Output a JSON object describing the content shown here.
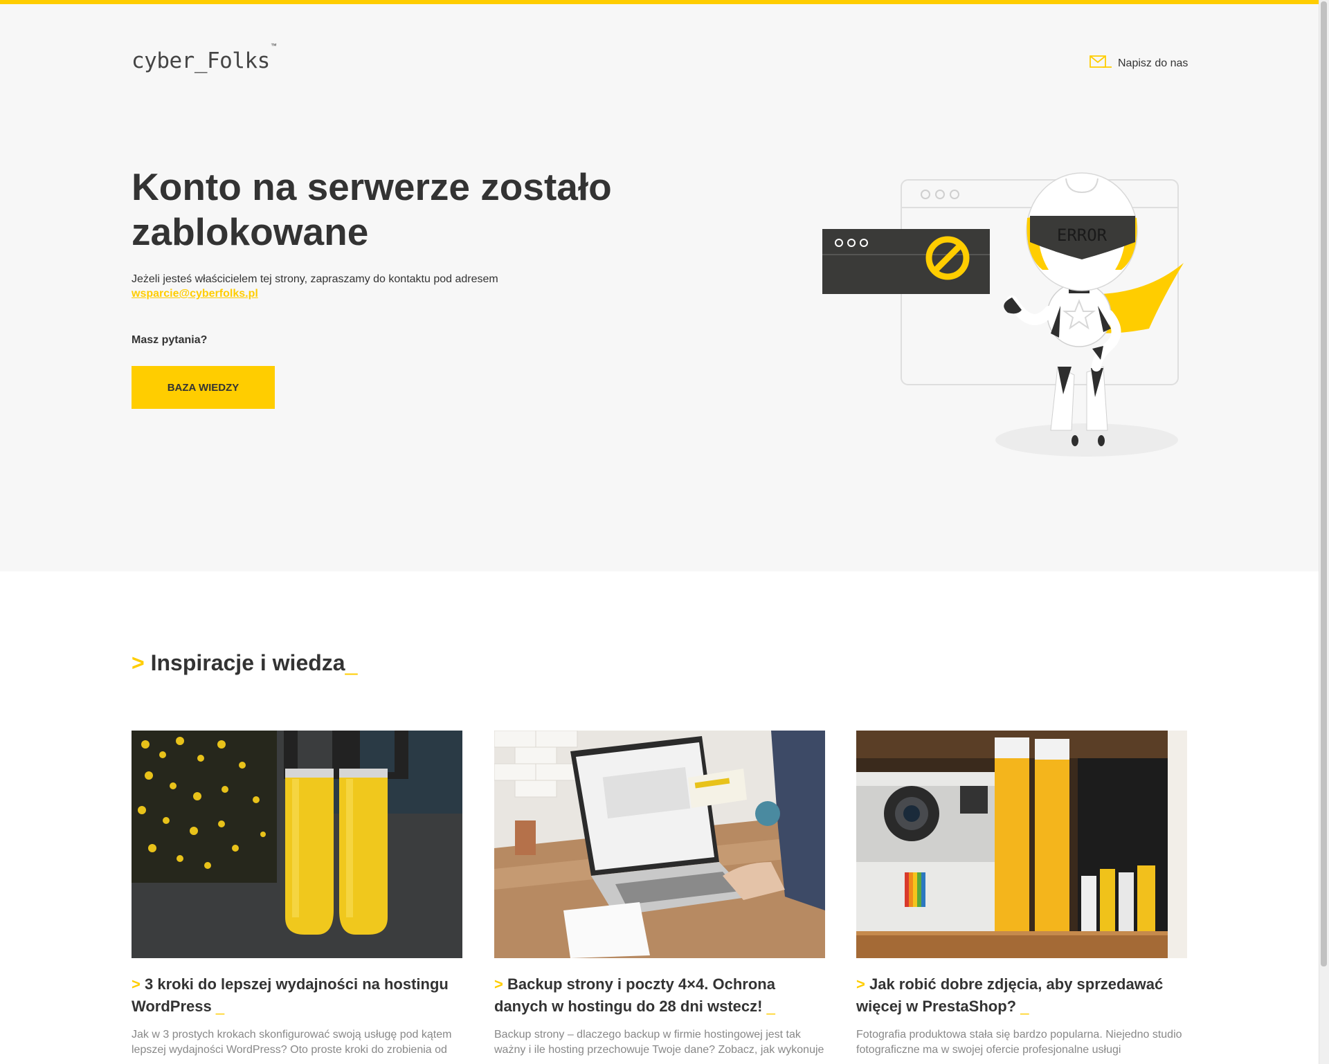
{
  "header": {
    "logo_text": "cyber_Folks",
    "logo_tm": "™",
    "contact_label": "Napisz do nas"
  },
  "hero": {
    "title": "Konto na serwerze zostało zablokowane",
    "text": "Jeżeli jesteś właścicielem tej strony, zapraszamy do kontaktu pod adresem",
    "email": "wsparcie@cyberfolks.pl",
    "question": "Masz pytania?",
    "cta_label": "BAZA WIEDZY",
    "illustration_label": "ERROR"
  },
  "section": {
    "prefix": ">",
    "title": "Inspiracje i wiedza",
    "suffix": "_"
  },
  "articles": [
    {
      "title": "3 kroki do lepszej wydajności na hostingu WordPress",
      "excerpt": "Jak w 3 prostych krokach skonfigurować swoją usługę pod kątem lepszej wydajności WordPress? Oto proste kroki do zrobienia od"
    },
    {
      "title": "Backup strony i poczty 4×4. Ochrona danych w hostingu do 28 dni wstecz!",
      "excerpt": "Backup strony – dlaczego backup w firmie hostingowej jest tak ważny i ile hosting przechowuje Twoje dane? Zobacz, jak wykonuje"
    },
    {
      "title": "Jak robić dobre zdjęcia, aby sprzedawać więcej w PrestaShop?",
      "excerpt": "Fotografia produktowa stała się bardzo popularna. Niejedno studio fotograficzne ma w swojej ofercie profesjonalne usługi"
    }
  ],
  "colors": {
    "accent": "#ffcd00",
    "text": "#333333",
    "muted": "#888888",
    "hero_bg": "#f7f7f7"
  }
}
